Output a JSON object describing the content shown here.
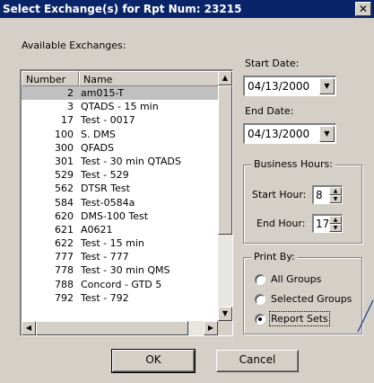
{
  "window": {
    "title": "Select Exchange(s) for Rpt Num: 23215",
    "close_symbol": "✕"
  },
  "available_label": "Available Exchanges:",
  "list": {
    "columns": {
      "number": "Number",
      "name": "Name"
    },
    "selected_index": 0,
    "rows": [
      {
        "number": "2",
        "name": "am015-T"
      },
      {
        "number": "3",
        "name": "QTADS - 15 min"
      },
      {
        "number": "17",
        "name": "Test - 0017"
      },
      {
        "number": "100",
        "name": "S. DMS"
      },
      {
        "number": "300",
        "name": "QFADS"
      },
      {
        "number": "301",
        "name": "Test - 30 min QTADS"
      },
      {
        "number": "529",
        "name": "Test - 529"
      },
      {
        "number": "562",
        "name": "DTSR Test"
      },
      {
        "number": "584",
        "name": "Test-0584a"
      },
      {
        "number": "620",
        "name": "DMS-100 Test"
      },
      {
        "number": "621",
        "name": "A0621"
      },
      {
        "number": "622",
        "name": "Test - 15 min"
      },
      {
        "number": "777",
        "name": "Test - 777"
      },
      {
        "number": "778",
        "name": "Test - 30 min QMS"
      },
      {
        "number": "788",
        "name": "Concord - GTD 5"
      },
      {
        "number": "792",
        "name": "Test - 792"
      }
    ]
  },
  "dates": {
    "start_label": "Start Date:",
    "start_value": "04/13/2000",
    "end_label": "End Date:",
    "end_value": "04/13/2000"
  },
  "business_hours": {
    "legend": "Business Hours:",
    "start_label": "Start Hour:",
    "start_value": "8",
    "end_label": "End Hour:",
    "end_value": "17"
  },
  "print_by": {
    "legend": "Print By:",
    "options": [
      "All Groups",
      "Selected Groups",
      "Report Sets"
    ],
    "selected": "Report Sets"
  },
  "buttons": {
    "ok": "OK",
    "cancel": "Cancel"
  },
  "icons": {
    "scroll_up": "▲",
    "scroll_down": "▼",
    "scroll_left": "◀",
    "scroll_right": "▶",
    "dropdown": "▼"
  },
  "colors": {
    "title_bar": "#0a246a",
    "face": "#d4d0c8",
    "selection": "#c0c0c0"
  }
}
